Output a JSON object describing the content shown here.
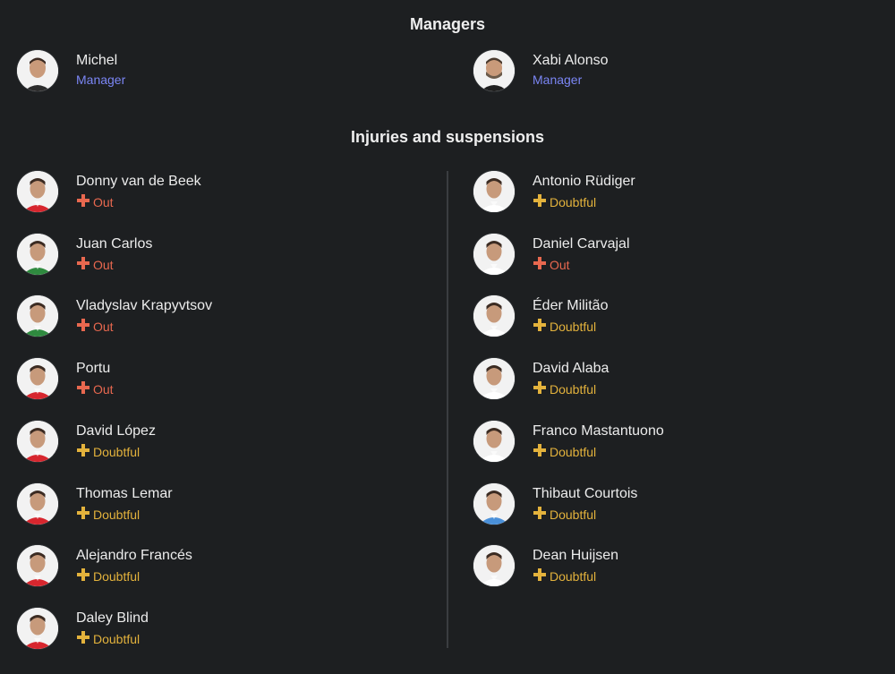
{
  "sections": {
    "managers_title": "Managers",
    "injuries_title": "Injuries and suspensions"
  },
  "managers": [
    {
      "name": "Michel",
      "role": "Manager"
    },
    {
      "name": "Xabi Alonso",
      "role": "Manager"
    }
  ],
  "colors": {
    "background": "#1d1f21",
    "role": "#7b86f5",
    "out": "#e8684f",
    "doubtful": "#e3b23c"
  },
  "injuries": {
    "home": [
      {
        "name": "Donny van de Beek",
        "status": "Out",
        "kind": "out",
        "kit": "#d7262e"
      },
      {
        "name": "Juan Carlos",
        "status": "Out",
        "kind": "out",
        "kit": "#2f8a3f"
      },
      {
        "name": "Vladyslav Krapyvtsov",
        "status": "Out",
        "kind": "out",
        "kit": "#2f8a3f"
      },
      {
        "name": "Portu",
        "status": "Out",
        "kind": "out",
        "kit": "#d7262e"
      },
      {
        "name": "David López",
        "status": "Doubtful",
        "kind": "doubtful",
        "kit": "#d7262e"
      },
      {
        "name": "Thomas Lemar",
        "status": "Doubtful",
        "kind": "doubtful",
        "kit": "#d7262e"
      },
      {
        "name": "Alejandro Francés",
        "status": "Doubtful",
        "kind": "doubtful",
        "kit": "#d7262e"
      },
      {
        "name": "Daley Blind",
        "status": "Doubtful",
        "kind": "doubtful",
        "kit": "#d7262e"
      }
    ],
    "away": [
      {
        "name": "Antonio Rüdiger",
        "status": "Doubtful",
        "kind": "doubtful",
        "kit": "#ffffff"
      },
      {
        "name": "Daniel Carvajal",
        "status": "Out",
        "kind": "out",
        "kit": "#ffffff"
      },
      {
        "name": "Éder Militão",
        "status": "Doubtful",
        "kind": "doubtful",
        "kit": "#ffffff"
      },
      {
        "name": "David Alaba",
        "status": "Doubtful",
        "kind": "doubtful",
        "kit": "#ffffff"
      },
      {
        "name": "Franco Mastantuono",
        "status": "Doubtful",
        "kind": "doubtful",
        "kit": "#ffffff"
      },
      {
        "name": "Thibaut Courtois",
        "status": "Doubtful",
        "kind": "doubtful",
        "kit": "#4a90d9"
      },
      {
        "name": "Dean Huijsen",
        "status": "Doubtful",
        "kind": "doubtful",
        "kit": "#ffffff"
      }
    ]
  }
}
